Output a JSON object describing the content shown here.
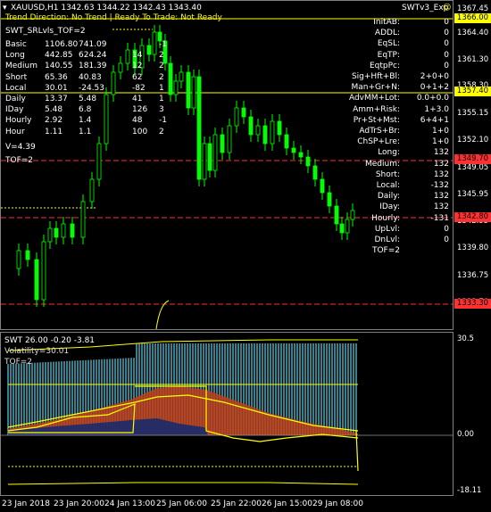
{
  "header": {
    "symbol_line": "XAUUSD,H1  1342.63 1344.22 1342.43 1343.40",
    "expert_name": "SWTv3_Exp",
    "smiley": "☺",
    "status_line": "Trend Direction: No Trend  |  Ready To Trade: Not Ready"
  },
  "left_panel": {
    "title": "SWT_SRLvls_TOF=2",
    "rows": [
      [
        "Basic",
        "1106.80",
        "741.09",
        "",
        "-1"
      ],
      [
        "Long",
        "442.85",
        "624.24",
        "14",
        "2"
      ],
      [
        "Medium",
        "140.55",
        "181.39",
        "12",
        "2"
      ],
      [
        "Short",
        "65.36",
        "40.83",
        "62",
        "2"
      ],
      [
        "Local",
        "30.01",
        "-24.53",
        "-82",
        "1"
      ],
      [
        "Daily",
        "13.37",
        "5.48",
        "41",
        "1"
      ],
      [
        "IDay",
        "5.48",
        "6.8",
        "126",
        "3"
      ],
      [
        "Hourly",
        "2.92",
        "1.4",
        "48",
        "-1"
      ],
      [
        "Hour",
        "1.11",
        "1.1",
        "100",
        "2"
      ]
    ],
    "v_line": "V=4.39",
    "tof_line": "TOF=2"
  },
  "right_panel": {
    "rows": [
      [
        "InitAB:",
        "0"
      ],
      [
        "ADDL:",
        "0"
      ],
      [
        "EqSL:",
        "0"
      ],
      [
        "EqTP:",
        "0"
      ],
      [
        "EqtpPc:",
        "0"
      ],
      [
        "Sig+Hft+Bl:",
        "2+0+0"
      ],
      [
        "Man+Gr+N:",
        "0+1+2"
      ],
      [
        "AdvMM+Lot:",
        "0.0+0.0"
      ],
      [
        "Amm+Risk:",
        "1+3.0"
      ],
      [
        "Pr+St+Mst:",
        "6+4+1"
      ],
      [
        "AdTrS+Br:",
        "1+0"
      ],
      [
        "ChSP+Lre:",
        "1+0"
      ],
      [
        "Long:",
        "132"
      ],
      [
        "Medium:",
        "132"
      ],
      [
        "Short:",
        "132"
      ],
      [
        "Local:",
        "-132"
      ],
      [
        "Daily:",
        "132"
      ],
      [
        "IDay:",
        "132"
      ],
      [
        "Hourly:",
        "-131"
      ],
      [
        "UpLvl:",
        "0"
      ],
      [
        "DnLvl:",
        "0"
      ],
      [
        "TOF=2",
        ""
      ]
    ]
  },
  "price_axis": {
    "labels": [
      "1367.45",
      "1364.40",
      "1361.30",
      "1358.30",
      "1355.15",
      "1352.10",
      "1349.05",
      "1345.95",
      "1342.95",
      "1339.80",
      "1336.75",
      "1333.70"
    ],
    "boxes": [
      {
        "value": "1366.00",
        "bg": "#ffff00",
        "fg": "#000000"
      },
      {
        "value": "1357.40",
        "bg": "#ffff00",
        "fg": "#000000"
      },
      {
        "value": "1349.70",
        "bg": "#ff3030",
        "fg": "#000000"
      },
      {
        "value": "1342.80",
        "bg": "#ff3030",
        "fg": "#000000"
      },
      {
        "value": "1333.30",
        "bg": "#ff3030",
        "fg": "#000000"
      }
    ]
  },
  "indicator": {
    "title": "SWT 26.00 -0.20 -3.81",
    "volatility": "Volatility=30.01",
    "tof": "TOF=2",
    "axis_labels": [
      "30.5",
      "0.00",
      "-18.11"
    ]
  },
  "time_axis": [
    "23 Jan 2018",
    "23 Jan 20:00",
    "24 Jan 13:00",
    "25 Jan 06:00",
    "25 Jan 22:00",
    "26 Jan 15:00",
    "29 Jan 08:00"
  ],
  "colors": {
    "candle": "#00ff00",
    "yellow": "#ffff00",
    "red": "#ff3030",
    "teal": "#4fb6c8",
    "rust": "#c0401a",
    "navy": "#1a2a6c"
  }
}
